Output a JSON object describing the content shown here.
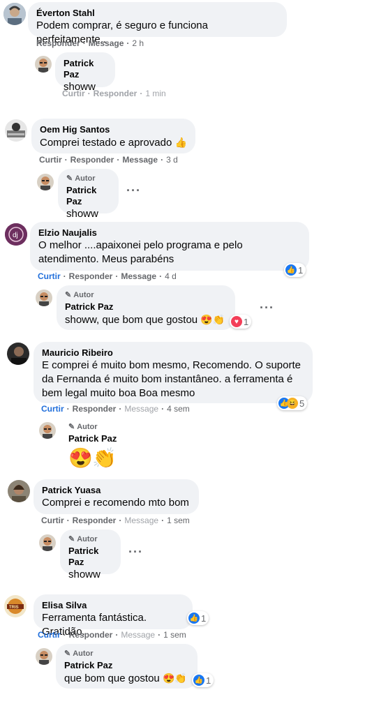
{
  "actions": {
    "like": "Curtir",
    "reply": "Responder",
    "message": "Message",
    "separator": "·"
  },
  "author_badge": "Autor",
  "comments": [
    {
      "name": "Éverton Stahl",
      "text": "Podem comprar, é seguro e funciona perfeitamente..",
      "time": "2 h",
      "reply": {
        "name": "Patrick Paz",
        "text": "showw",
        "time": "1 min",
        "author": false
      }
    },
    {
      "name": "Oem Hig Santos",
      "text": "Comprei testado e aprovado",
      "time": "3 d",
      "reply": {
        "name": "Patrick Paz",
        "text": "showw",
        "author": true
      }
    },
    {
      "name": "Elzio Naujalis",
      "text": "O melhor ....apaixonei pelo programa e pelo atendimento. Meus parabéns",
      "time": "4 d",
      "reactions": "1",
      "reply": {
        "name": "Patrick Paz",
        "text": "showw, que bom que gostou",
        "reactions": "1",
        "author": true
      }
    },
    {
      "name": "Mauricio Ribeiro",
      "text": "E comprei é muito bom mesmo, Recomendo. O suporte da Fernanda é muito bom instantâneo. a ferramenta é bem legal muito boa Boa mesmo",
      "time": "4 sem",
      "reactions": "5",
      "reply": {
        "name": "Patrick Paz",
        "author": true
      }
    },
    {
      "name": "Patrick Yuasa",
      "text": "Comprei e recomendo mto bom",
      "time": "1 sem",
      "reply": {
        "name": "Patrick Paz",
        "text": "showw",
        "author": true
      }
    },
    {
      "name": "Elisa Silva",
      "text": "Ferramenta fantástica. Gratidão.",
      "time": "1 sem",
      "reactions": "1",
      "reply": {
        "name": "Patrick Paz",
        "text": "que bom que gostou",
        "reactions": "1",
        "author": true
      }
    }
  ],
  "colors": {
    "bubble": "#f0f2f5",
    "secondary_text": "#65676b",
    "like_blue": "#1877f2",
    "link_blue": "#216fdb"
  }
}
